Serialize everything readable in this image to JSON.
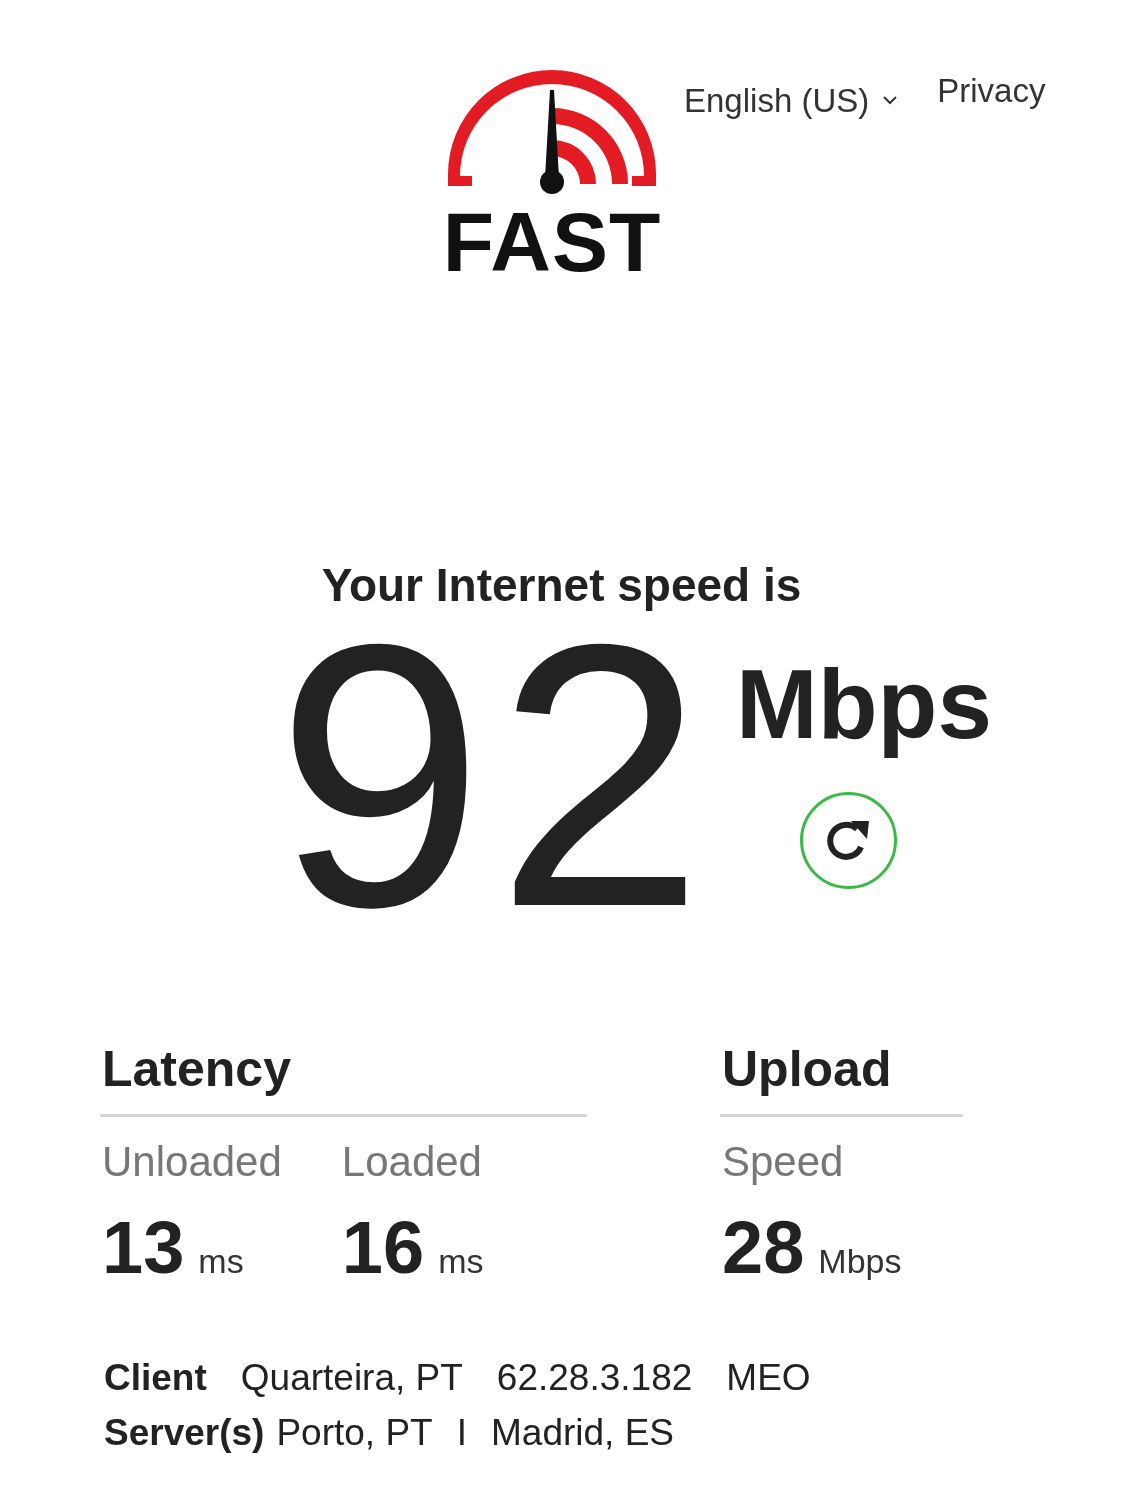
{
  "header": {
    "language": "English (US)",
    "privacy": "Privacy"
  },
  "logo": {
    "text": "FAST"
  },
  "speed": {
    "heading": "Your Internet speed is",
    "value": "92",
    "unit": "Mbps"
  },
  "latency": {
    "title": "Latency",
    "items": [
      {
        "label": "Unloaded",
        "value": "13",
        "unit": "ms"
      },
      {
        "label": "Loaded",
        "value": "16",
        "unit": "ms"
      }
    ]
  },
  "upload": {
    "title": "Upload",
    "items": [
      {
        "label": "Speed",
        "value": "28",
        "unit": "Mbps"
      }
    ]
  },
  "client": {
    "label": "Client",
    "values": [
      "Quarteira, PT",
      "62.28.3.182",
      "MEO"
    ]
  },
  "servers": {
    "label": "Server(s)",
    "values": [
      "Porto, PT",
      "I",
      "Madrid, ES"
    ]
  }
}
